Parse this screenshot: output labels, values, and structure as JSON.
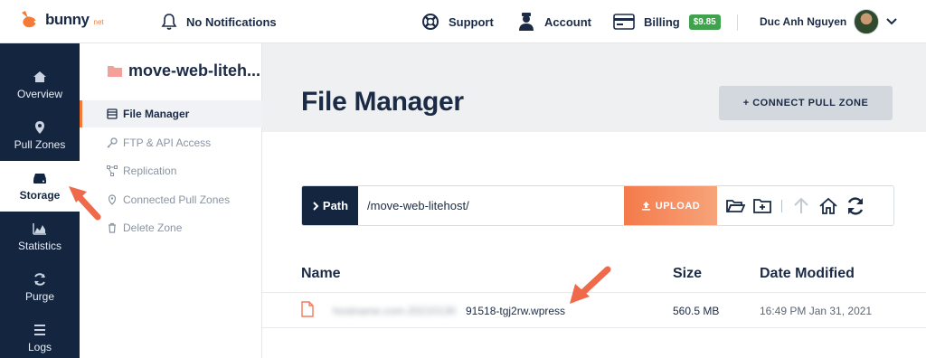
{
  "brand": {
    "name": "bunny",
    "suffix": "net"
  },
  "topbar": {
    "notifications": "No Notifications",
    "support": "Support",
    "account": "Account",
    "billing": "Billing",
    "balance": "$9.85",
    "user_name": "Duc Anh Nguyen"
  },
  "leftnav": {
    "items": [
      {
        "label": "Overview",
        "icon": "home-icon"
      },
      {
        "label": "Pull Zones",
        "icon": "location-pin-icon"
      },
      {
        "label": "Storage",
        "icon": "storage-drive-icon",
        "active": true
      },
      {
        "label": "Statistics",
        "icon": "chart-icon"
      },
      {
        "label": "Purge",
        "icon": "refresh-icon"
      },
      {
        "label": "Logs",
        "icon": "logs-icon"
      }
    ]
  },
  "subnav": {
    "zone_title": "move-web-liteh...",
    "items": [
      {
        "label": "File Manager",
        "active": true
      },
      {
        "label": "FTP & API Access"
      },
      {
        "label": "Replication"
      },
      {
        "label": "Connected Pull Zones"
      },
      {
        "label": "Delete Zone"
      }
    ]
  },
  "main": {
    "title": "File Manager",
    "connect_label": "+ CONNECT PULL ZONE",
    "path_label": "Path",
    "path_value": "/move-web-litehost/",
    "upload_label": "UPLOAD",
    "columns": {
      "name": "Name",
      "size": "Size",
      "date": "Date Modified"
    },
    "files": [
      {
        "name_hidden": "hostname.com-20210130",
        "name_visible": "91518-tgj2rw.wpress",
        "size": "560.5 MB",
        "modified": "16:49 PM Jan 31, 2021"
      }
    ]
  },
  "colors": {
    "navy": "#14263f",
    "accent_orange": "#f47a36",
    "badge_green": "#3fa34d",
    "annotation_arrow": "#ef6a4a"
  }
}
